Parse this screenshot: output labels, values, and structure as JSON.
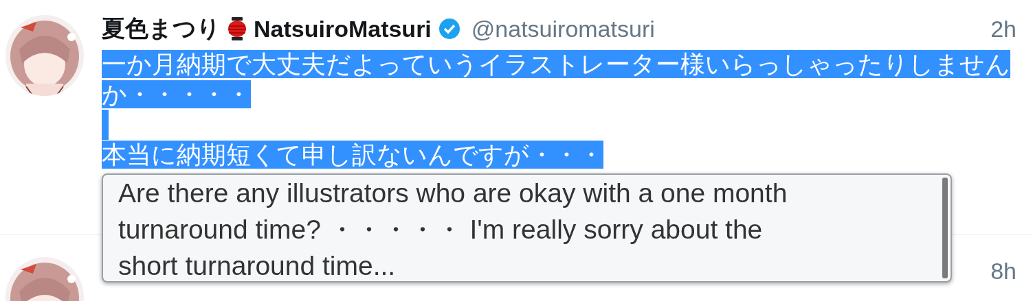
{
  "tweets": [
    {
      "display_name": "夏色まつり",
      "account_name": "NatsuiroMatsuri",
      "verified": true,
      "handle": "@natsuiromatsuri",
      "time": "2h",
      "text_selected": true,
      "paragraphs": [
        [
          "一か月納期で大丈夫だよっていうイラストレーター様いらっしゃったりしません",
          "か・・・・・"
        ],
        [
          "本当に納期短くて申し訳ないんですが・・・"
        ]
      ]
    },
    {
      "time": "8h"
    }
  ],
  "translation_popup": {
    "text": "Are there any illustrators who are okay with a one month turnaround time? ・・・・・ I'm really sorry about the short turnaround time..."
  }
}
